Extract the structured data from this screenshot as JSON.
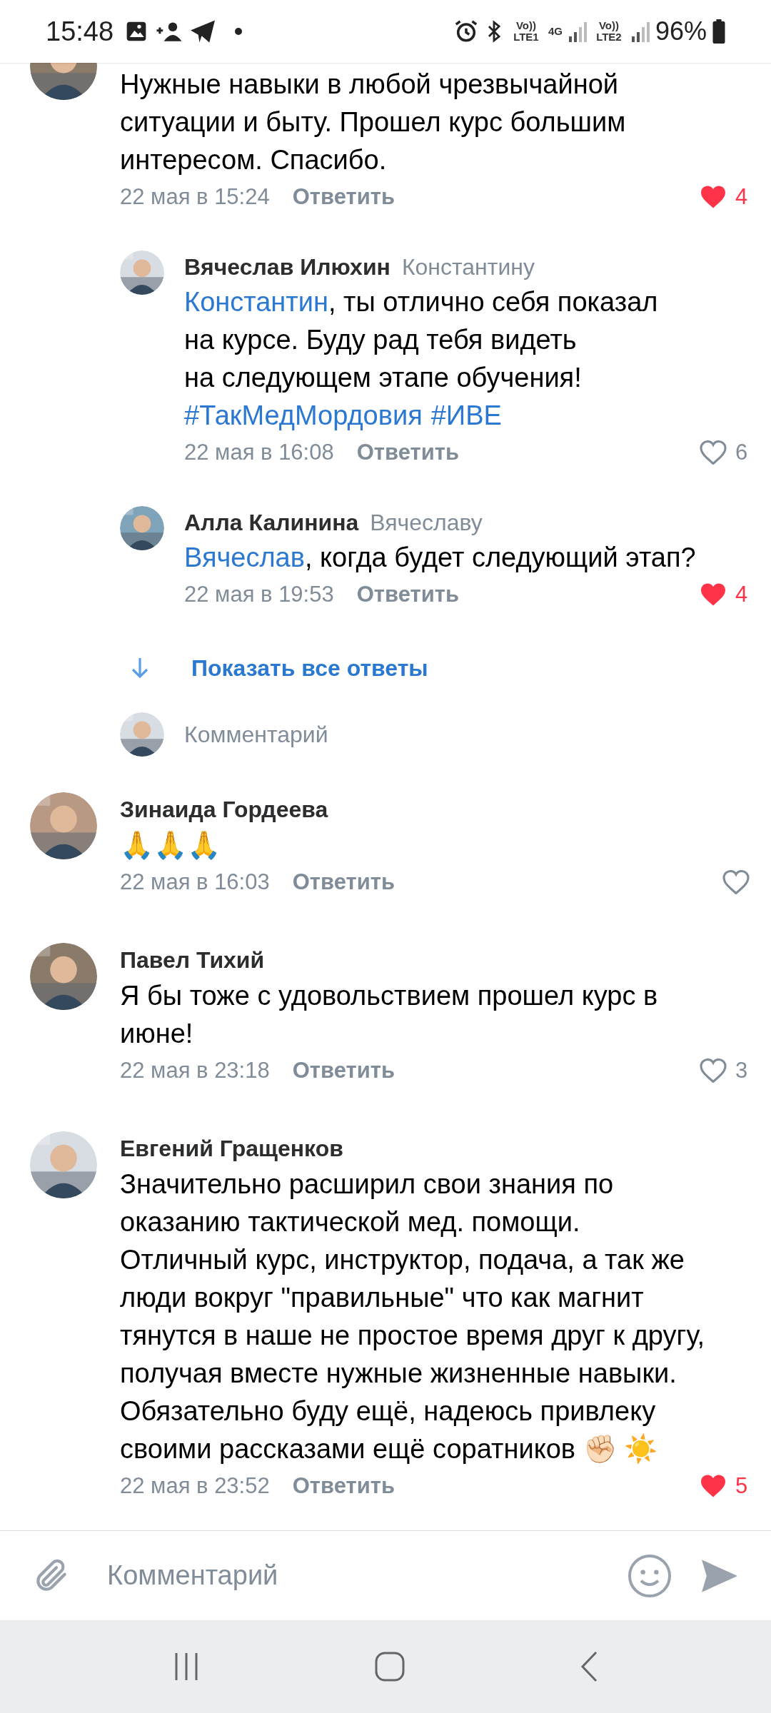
{
  "status_bar": {
    "time": "15:48",
    "network_1": "Vo)) LTE1",
    "data": "4G",
    "network_2": "Vo)) LTE2",
    "battery": "96%"
  },
  "thread": [
    {
      "kind": "comment",
      "text": "Нужные навыки в любой чрезвычайной\nситуации и быту. Прошел курс большим\nинтересом. Спасибо.",
      "date": "22 мая в 15:24",
      "reply": "Ответить",
      "liked": true,
      "likes": "4"
    },
    {
      "kind": "reply",
      "name": "Вячеслав Илюхин",
      "to": "Константину",
      "mention": "Константин",
      "text": ", ты отлично себя показал\nна курсе. Буду рад тебя видеть\nна следующем этапе обучения!",
      "hashtags": [
        "#ТакМедМордовия",
        "#ИВЕ"
      ],
      "date": "22 мая в 16:08",
      "reply": "Ответить",
      "liked": false,
      "likes": "6"
    },
    {
      "kind": "reply",
      "name": "Алла Калинина",
      "to": "Вячеславу",
      "mention": "Вячеслав",
      "text": ", когда будет следующий этап?",
      "date": "22 мая в 19:53",
      "reply": "Ответить",
      "liked": true,
      "likes": "4"
    },
    {
      "kind": "show_all",
      "label": "Показать все ответы"
    },
    {
      "kind": "reply_input",
      "placeholder": "Комментарий"
    },
    {
      "kind": "comment",
      "name": "Зинаида Гордеева",
      "text": "🙏🙏🙏",
      "date": "22 мая в 16:03",
      "reply": "Ответить",
      "liked": false
    },
    {
      "kind": "comment",
      "name": "Павел Тихий",
      "text": "Я бы тоже с удовольствием прошел курс в\nиюне!",
      "date": "22 мая в 23:18",
      "reply": "Ответить",
      "liked": false,
      "likes": "3"
    },
    {
      "kind": "comment",
      "name": "Евгений Гращенков",
      "text": "Значительно расширил свои знания по\nоказанию тактической мед. помощи.\nОтличный курс, инструктор, подача, а так же\nлюди вокруг \"правильные\" что как магнит\nтянутся в наше не простое время друг к другу,\nполучая вместе нужные жизненные навыки.\nОбязательно буду ещё, надеюсь привлеку\nсвоими рассказами ещё соратников ✊🏻 ☀️",
      "date": "22 мая в 23:52",
      "reply": "Ответить",
      "liked": true,
      "likes": "5"
    }
  ],
  "composer": {
    "placeholder": "Комментарий"
  }
}
